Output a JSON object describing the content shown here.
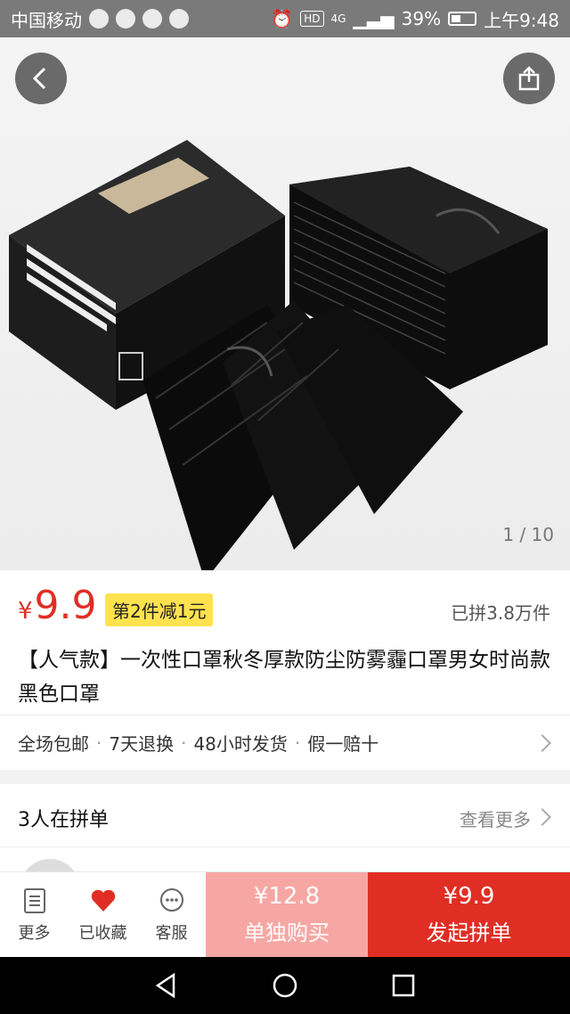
{
  "status_bar": {
    "carrier": "中国移动",
    "network": "HD",
    "signal": "4G",
    "battery_percent": "39%",
    "time": "上午9:48"
  },
  "hero": {
    "pager": "1 / 10",
    "back_icon": "chevron-left-icon",
    "share_icon": "share-icon"
  },
  "product": {
    "currency": "¥",
    "price": "9.9",
    "promo": "第2件减1元",
    "sold": "已拼3.8万件",
    "title": "【人气款】一次性口罩秋冬厚款防尘防雾霾口罩男女时尚款黑色口罩",
    "services": [
      "全场包邮",
      "7天退换",
      "48小时发货",
      "假一赔十"
    ]
  },
  "group": {
    "heading": "3人在拼单",
    "more": "查看更多"
  },
  "action_bar": {
    "more_label": "更多",
    "fav_label": "已收藏",
    "service_label": "客服",
    "single_price": "¥12.8",
    "single_label": "单独购买",
    "group_price": "¥9.9",
    "group_label": "发起拼单"
  },
  "colors": {
    "accent": "#e02e24",
    "promo_bg": "#ffe24d",
    "single_bg": "#f6a7a3"
  }
}
